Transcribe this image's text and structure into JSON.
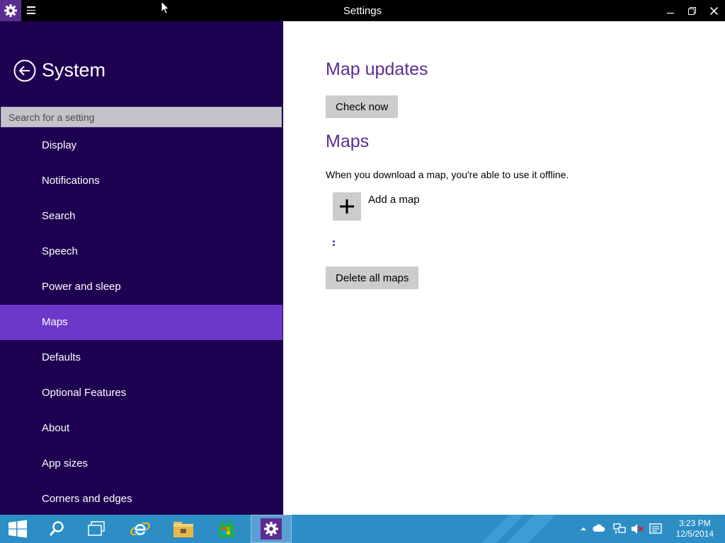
{
  "window": {
    "title": "Settings",
    "app_icon": "gear-icon",
    "menu_icon": "hamburger-icon",
    "controls": [
      "minimize-icon",
      "restore-icon",
      "close-icon"
    ]
  },
  "sidebar": {
    "back_icon": "back-arrow-icon",
    "title": "System",
    "search_placeholder": "Search for a setting",
    "items": [
      {
        "label": "Display",
        "active": false
      },
      {
        "label": "Notifications",
        "active": false
      },
      {
        "label": "Search",
        "active": false
      },
      {
        "label": "Speech",
        "active": false
      },
      {
        "label": "Power and sleep",
        "active": false
      },
      {
        "label": "Maps",
        "active": true
      },
      {
        "label": "Defaults",
        "active": false
      },
      {
        "label": "Optional Features",
        "active": false
      },
      {
        "label": "About",
        "active": false
      },
      {
        "label": "App sizes",
        "active": false
      },
      {
        "label": "Corners and edges",
        "active": false
      }
    ]
  },
  "main": {
    "map_updates_heading": "Map updates",
    "check_now_label": "Check now",
    "maps_heading": "Maps",
    "maps_description": "When you download a map, you're able to use it offline.",
    "add_map_label": "Add a map",
    "add_map_icon": "plus-icon",
    "delete_all_label": "Delete all maps"
  },
  "taskbar": {
    "apps": [
      "start-icon",
      "search-icon",
      "task-view-icon",
      "internet-explorer-icon",
      "file-explorer-icon",
      "store-icon",
      "settings-icon"
    ],
    "active_app": "settings-icon",
    "tray_icons": [
      "show-hidden-icons-chevron",
      "onedrive-icon",
      "network-icon",
      "volume-muted-icon",
      "action-center-icon"
    ],
    "time": "3:23 PM",
    "date": "12/5/2014"
  },
  "colors": {
    "sidebar_bg": "#1e0051",
    "sidebar_active": "#6b38c9",
    "accent_heading": "#5c2d91",
    "taskbar_bg": "#2d8ec5",
    "button_gray": "#cccccc"
  }
}
